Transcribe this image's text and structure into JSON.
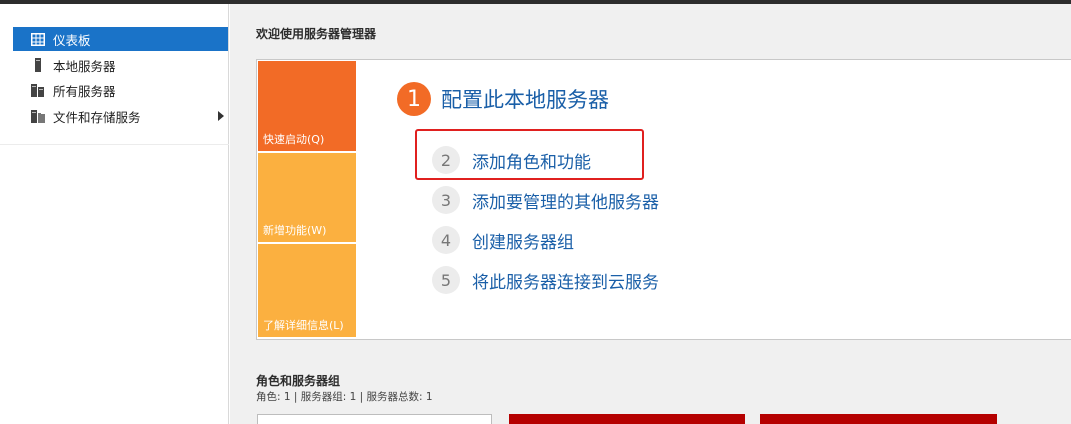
{
  "colors": {
    "accent_blue": "#1a73c8",
    "link_blue": "#1a5fa8",
    "orange": "#f26b26",
    "amber": "#fbb040",
    "highlight_red": "#e0201f",
    "card_red": "#b50000"
  },
  "sidebar": {
    "items": [
      {
        "label": "仪表板",
        "icon": "dashboard-grid-icon",
        "active": true
      },
      {
        "label": "本地服务器",
        "icon": "server-icon",
        "active": false
      },
      {
        "label": "所有服务器",
        "icon": "servers-icon",
        "active": false
      },
      {
        "label": "文件和存储服务",
        "icon": "file-storage-icon",
        "active": false,
        "has_submenu": true
      }
    ]
  },
  "main": {
    "welcome_title": "欢迎使用服务器管理器",
    "tiles": [
      {
        "label": "快速启动(Q)"
      },
      {
        "label": "新增功能(W)"
      },
      {
        "label": "了解详细信息(L)"
      }
    ],
    "steps": [
      {
        "num": "1",
        "label": "配置此本地服务器"
      },
      {
        "num": "2",
        "label": "添加角色和功能"
      },
      {
        "num": "3",
        "label": "添加要管理的其他服务器"
      },
      {
        "num": "4",
        "label": "创建服务器组"
      },
      {
        "num": "5",
        "label": "将此服务器连接到云服务"
      }
    ],
    "roles": {
      "title": "角色和服务器组",
      "subtitle": "角色: 1 | 服务器组: 1 | 服务器总数: 1"
    }
  }
}
